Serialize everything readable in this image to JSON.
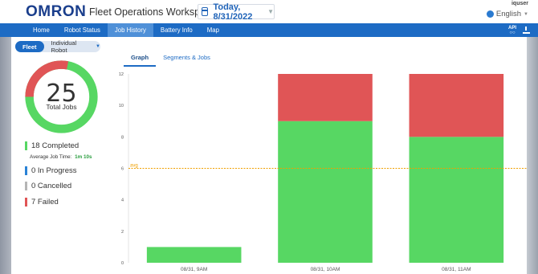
{
  "header": {
    "logo": "OMRON",
    "app_title": "Fleet Operations Workspace iQ",
    "date": "Today, 8/31/2022",
    "user": "iquser",
    "language": "English"
  },
  "nav": {
    "items": [
      {
        "label": "Home",
        "active": false
      },
      {
        "label": "Robot Status",
        "active": false
      },
      {
        "label": "Job History",
        "active": true
      },
      {
        "label": "Battery Info",
        "active": false
      },
      {
        "label": "Map",
        "active": false
      }
    ],
    "api_label": "API"
  },
  "toggle": {
    "fleet": "Fleet",
    "robot": "Individual Robot"
  },
  "summary": {
    "total": "25",
    "total_label": "Total Jobs",
    "completed": "18 Completed",
    "avg_label": "Average Job Time:",
    "avg_value": "1m 10s",
    "in_progress": "0 In Progress",
    "cancelled": "0 Cancelled",
    "failed": "7 Failed",
    "donut": {
      "completed": 18,
      "failed": 7,
      "total": 25
    }
  },
  "tabs": [
    {
      "label": "Graph",
      "active": true
    },
    {
      "label": "Segments & Jobs",
      "active": false
    }
  ],
  "colors": {
    "completed": "#57d763",
    "failed": "#e05556",
    "in_progress": "#2a82d6",
    "cancelled": "#b5b5b5",
    "avg": "#f0a000",
    "brand": "#1d6bc4"
  },
  "chart_data": {
    "type": "bar",
    "stacked": true,
    "categories": [
      "08/31, 9AM",
      "08/31, 10AM",
      "08/31, 11AM"
    ],
    "series": [
      {
        "values": [
          1,
          9,
          8
        ],
        "color": "#57d763"
      },
      {
        "values": [
          0,
          3,
          4
        ],
        "color": "#e05556"
      }
    ],
    "ylim": [
      0,
      12
    ],
    "yticks": [
      0,
      2,
      4,
      6,
      8,
      10,
      12
    ],
    "avg_line": {
      "label": "avg",
      "value": 6
    },
    "grid": false
  }
}
